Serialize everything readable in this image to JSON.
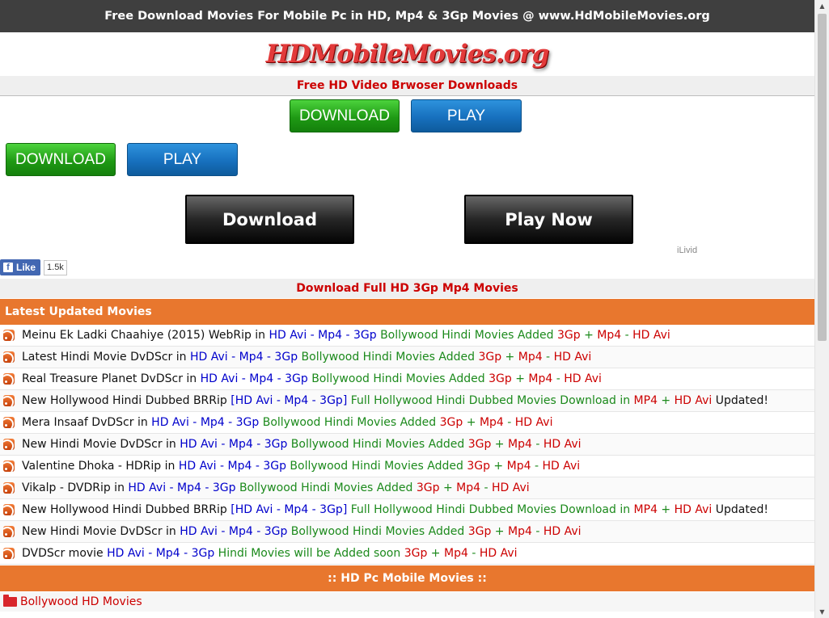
{
  "header": {
    "banner": "Free Download Movies For Mobile Pc in HD, Mp4 & 3Gp Movies @ www.HdMobileMovies.org",
    "logo_text": "HDMobileMovies.org"
  },
  "browser_ad": {
    "title": "Free HD Video Brwoser Downloads",
    "download_label": "DOWNLOAD",
    "play_label": "PLAY"
  },
  "second_ad": {
    "download_label": "DOWNLOAD",
    "play_label": "PLAY"
  },
  "ilivid_ad": {
    "download_label": "Download",
    "play_label": "Play Now",
    "sponsor": "iLivid"
  },
  "facebook": {
    "like_label": "Like",
    "count": "1.5k"
  },
  "section_title": "Download Full HD 3Gp Mp4 Movies",
  "latest": {
    "heading": "Latest Updated Movies",
    "items": [
      [
        [
          "black",
          "Meinu Ek Ladki Chaahiye (2015) WebRip in "
        ],
        [
          "blue",
          "HD Avi - Mp4 - 3Gp"
        ],
        [
          "green",
          " Bollywood Hindi Movies Added "
        ],
        [
          "red",
          "3Gp"
        ],
        [
          "green",
          " + "
        ],
        [
          "red",
          "Mp4"
        ],
        [
          "green",
          " - "
        ],
        [
          "red",
          "HD Avi"
        ]
      ],
      [
        [
          "black",
          "Latest Hindi Movie DvDScr in "
        ],
        [
          "blue",
          "HD Avi - Mp4 - 3Gp"
        ],
        [
          "green",
          " Bollywood Hindi Movies Added "
        ],
        [
          "red",
          "3Gp"
        ],
        [
          "green",
          " + "
        ],
        [
          "red",
          "Mp4"
        ],
        [
          "green",
          " - "
        ],
        [
          "red",
          "HD Avi"
        ]
      ],
      [
        [
          "black",
          "Real Treasure Planet DvDScr in "
        ],
        [
          "blue",
          "HD Avi - Mp4 - 3Gp"
        ],
        [
          "green",
          " Bollywood Hindi Movies Added "
        ],
        [
          "red",
          "3Gp"
        ],
        [
          "green",
          " + "
        ],
        [
          "red",
          "Mp4"
        ],
        [
          "green",
          " - "
        ],
        [
          "red",
          "HD Avi"
        ]
      ],
      [
        [
          "black",
          "New Hollywood Hindi Dubbed BRRip "
        ],
        [
          "blue",
          "[HD Avi - Mp4 - 3Gp]"
        ],
        [
          "green",
          " Full Hollywood Hindi Dubbed Movies Download in "
        ],
        [
          "red",
          "MP4"
        ],
        [
          "green",
          " + "
        ],
        [
          "red",
          "HD Avi"
        ],
        [
          "black",
          " Updated!"
        ]
      ],
      [
        [
          "black",
          "Mera Insaaf DvDScr in "
        ],
        [
          "blue",
          "HD Avi - Mp4 - 3Gp"
        ],
        [
          "green",
          " Bollywood Hindi Movies Added "
        ],
        [
          "red",
          "3Gp"
        ],
        [
          "green",
          " + "
        ],
        [
          "red",
          "Mp4"
        ],
        [
          "green",
          " - "
        ],
        [
          "red",
          "HD Avi"
        ]
      ],
      [
        [
          "black",
          "New Hindi Movie DvDScr in "
        ],
        [
          "blue",
          "HD Avi - Mp4 - 3Gp"
        ],
        [
          "green",
          " Bollywood Hindi Movies Added "
        ],
        [
          "red",
          "3Gp"
        ],
        [
          "green",
          " + "
        ],
        [
          "red",
          "Mp4"
        ],
        [
          "green",
          " - "
        ],
        [
          "red",
          "HD Avi"
        ]
      ],
      [
        [
          "black",
          "Valentine Dhoka - HDRip in "
        ],
        [
          "blue",
          "HD Avi - Mp4 - 3Gp"
        ],
        [
          "green",
          " Bollywood Hindi Movies Added "
        ],
        [
          "red",
          "3Gp"
        ],
        [
          "green",
          " + "
        ],
        [
          "red",
          "Mp4"
        ],
        [
          "green",
          " - "
        ],
        [
          "red",
          "HD Avi"
        ]
      ],
      [
        [
          "black",
          "Vikalp - DVDRip in "
        ],
        [
          "blue",
          "HD Avi - Mp4 - 3Gp"
        ],
        [
          "green",
          " Bollywood Hindi Movies Added "
        ],
        [
          "red",
          "3Gp"
        ],
        [
          "green",
          " + "
        ],
        [
          "red",
          "Mp4"
        ],
        [
          "green",
          " - "
        ],
        [
          "red",
          "HD Avi"
        ]
      ],
      [
        [
          "black",
          "New Hollywood Hindi Dubbed BRRip "
        ],
        [
          "blue",
          "[HD Avi - Mp4 - 3Gp]"
        ],
        [
          "green",
          " Full Hollywood Hindi Dubbed Movies Download in "
        ],
        [
          "red",
          "MP4"
        ],
        [
          "green",
          " + "
        ],
        [
          "red",
          "HD Avi"
        ],
        [
          "black",
          " Updated!"
        ]
      ],
      [
        [
          "black",
          "New Hindi Movie DvDScr in "
        ],
        [
          "blue",
          "HD Avi - Mp4 - 3Gp"
        ],
        [
          "green",
          " Bollywood Hindi Movies Added "
        ],
        [
          "red",
          "3Gp"
        ],
        [
          "green",
          " + "
        ],
        [
          "red",
          "Mp4"
        ],
        [
          "green",
          " - "
        ],
        [
          "red",
          "HD Avi"
        ]
      ],
      [
        [
          "black",
          "DVDScr movie "
        ],
        [
          "blue",
          "HD Avi - Mp4 - 3Gp"
        ],
        [
          "green",
          " Hindi Movies will be Added soon "
        ],
        [
          "red",
          "3Gp"
        ],
        [
          "green",
          " + "
        ],
        [
          "red",
          "Mp4"
        ],
        [
          "green",
          " - "
        ],
        [
          "red",
          "HD Avi"
        ]
      ]
    ]
  },
  "categories": {
    "heading": ":: HD Pc Mobile Movies ::",
    "first_item": "Bollywood HD Movies"
  },
  "colors": {
    "accent_orange": "#e8772e",
    "link_red": "#cc0000",
    "link_blue": "#0000cc",
    "link_green": "#1c8a1c",
    "topbar": "#3f3f3f"
  },
  "icons": {
    "list_bullet": "rss-icon",
    "category_bullet": "folder-icon",
    "facebook": "facebook-f-icon"
  }
}
